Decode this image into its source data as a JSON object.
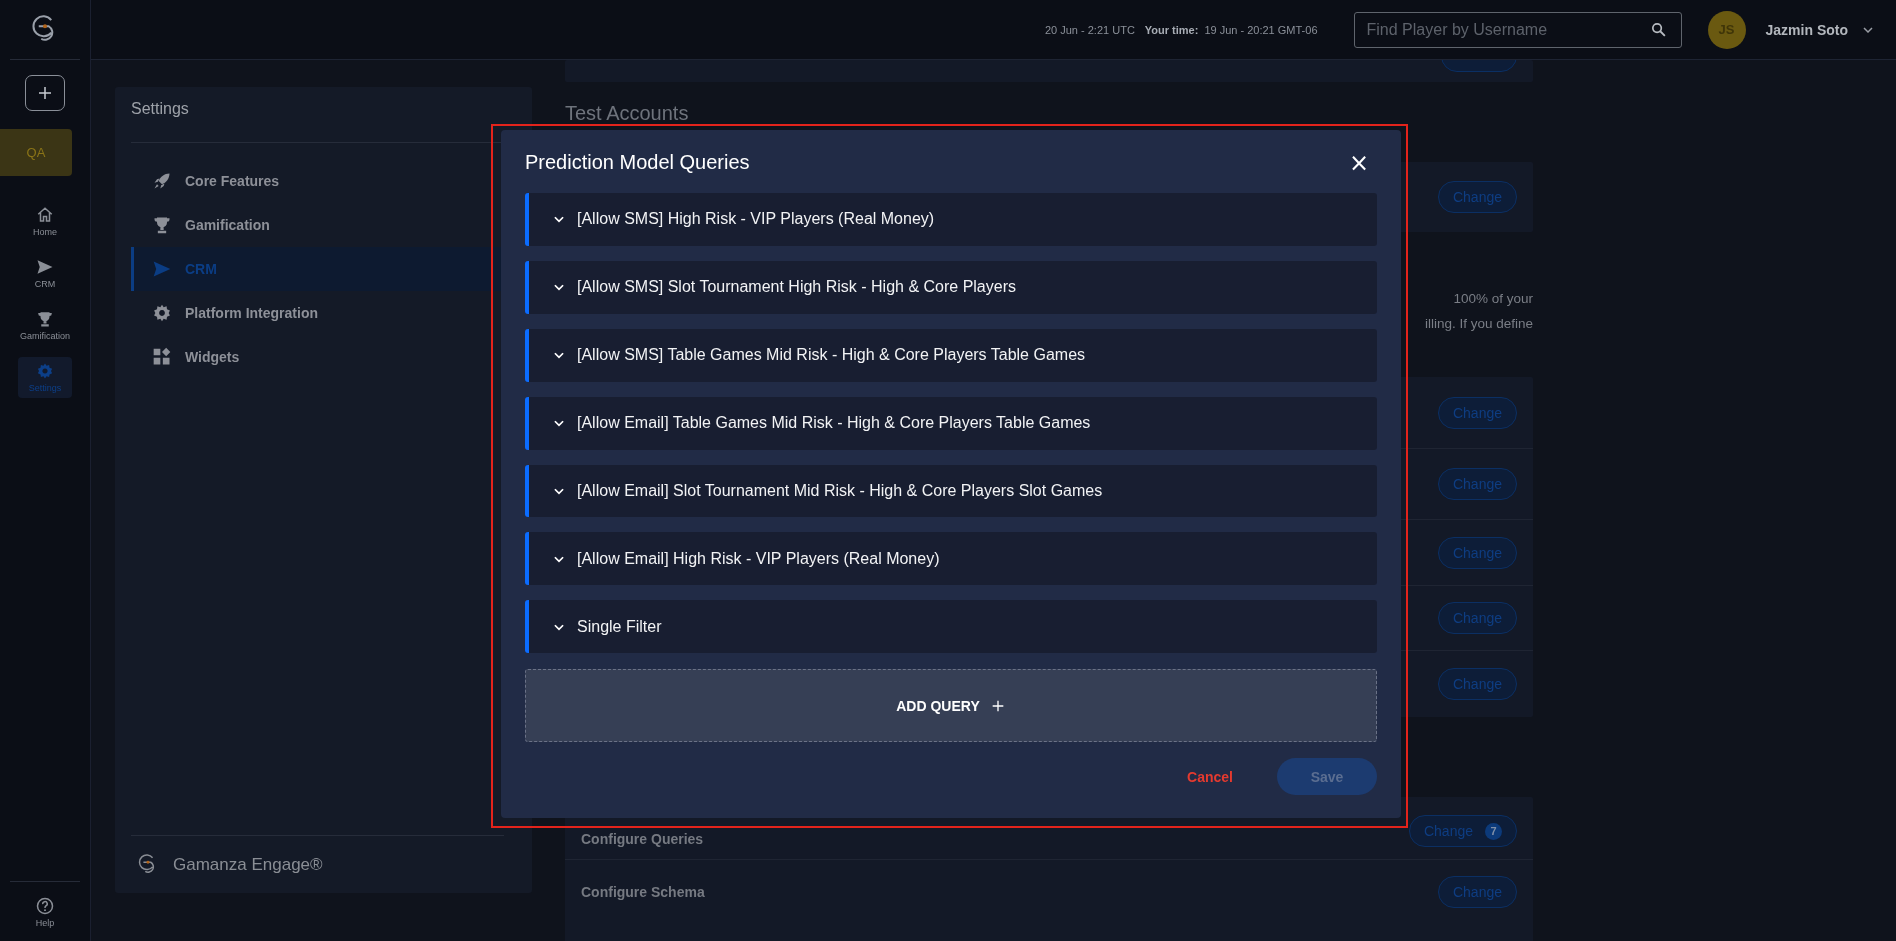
{
  "rail": {
    "env_badge": "QA",
    "items": [
      {
        "kind": "home",
        "label": "Home",
        "selected": false
      },
      {
        "kind": "crm",
        "label": "CRM",
        "selected": false
      },
      {
        "kind": "gamification",
        "label": "Gamification",
        "selected": false
      },
      {
        "kind": "settings",
        "label": "Settings",
        "selected": true
      }
    ],
    "help": "Help"
  },
  "topbar": {
    "server_time": "20 Jun - 2:21 UTC",
    "your_time_label": "Your time:",
    "your_time": "19 Jun - 20:21 GMT-06",
    "search": {
      "placeholder": "Find Player by Username"
    },
    "user": {
      "initials": "JS",
      "name": "Jazmin Soto"
    }
  },
  "settings_nav": {
    "title": "Settings",
    "items": [
      {
        "kind": "rocket",
        "label": "Core Features",
        "selected": false
      },
      {
        "kind": "trophy",
        "label": "Gamification",
        "selected": false
      },
      {
        "kind": "send",
        "label": "CRM",
        "selected": true
      },
      {
        "kind": "gear",
        "label": "Platform Integration",
        "selected": false
      },
      {
        "kind": "widgets",
        "label": "Widgets",
        "selected": false
      }
    ],
    "footer": "Gamanza Engage®"
  },
  "content": {
    "heading": "Test Accounts",
    "test_card": {
      "button": "Change"
    },
    "description_lines": [
      "100% of your",
      "illing. If you define"
    ],
    "settings_rows": [
      {
        "button": "Change"
      },
      {
        "button": "Change"
      },
      {
        "button": "Change"
      },
      {
        "button": "Change"
      },
      {
        "button": "Change"
      }
    ],
    "config_rows": [
      {
        "label": "Configure Queries",
        "button": "Change",
        "badge": "7"
      },
      {
        "label": "Configure Schema",
        "button": "Change"
      }
    ]
  },
  "modal": {
    "highlighted": true,
    "title": "Prediction Model Queries",
    "close": "×",
    "queries": [
      {
        "label": "[Allow SMS] High Risk - VIP Players (Real Money)",
        "expanded": false
      },
      {
        "label": "[Allow SMS] Slot Tournament High Risk - High & Core Players",
        "expanded": false
      },
      {
        "label": "[Allow SMS] Table Games Mid Risk - High & Core Players Table Games",
        "expanded": false
      },
      {
        "label": "[Allow Email] Table Games Mid Risk - High & Core Players Table Games",
        "expanded": false
      },
      {
        "label": "[Allow Email] Slot Tournament Mid Risk - High & Core Players Slot Games",
        "expanded": false
      },
      {
        "label": "[Allow Email] High Risk - VIP Players (Real Money)",
        "expanded": false
      },
      {
        "label": "Single Filter",
        "expanded": false
      }
    ],
    "add_button": "ADD QUERY",
    "cancel": "Cancel",
    "save": {
      "label": "Save",
      "disabled": true
    }
  }
}
